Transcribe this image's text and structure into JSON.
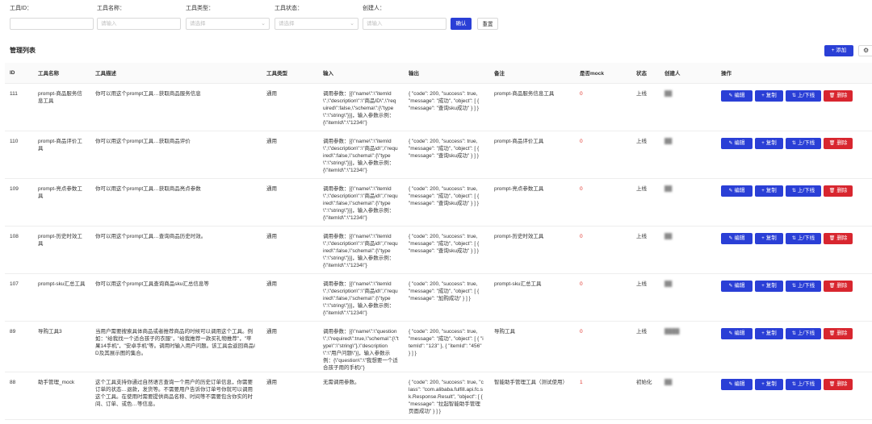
{
  "filters": {
    "tool_id": {
      "label": "工具ID：",
      "placeholder": ""
    },
    "tool_name": {
      "label": "工具名称：",
      "placeholder": "请输入"
    },
    "tool_type": {
      "label": "工具类型：",
      "placeholder": "请选择"
    },
    "tool_status": {
      "label": "工具状态：",
      "placeholder": "请选择"
    },
    "creator": {
      "label": "创建人：",
      "placeholder": "请输入"
    },
    "confirm_label": "确认",
    "reset_label": "重置"
  },
  "list": {
    "title": "管理列表",
    "add_label": "+ 添加",
    "settings_icon": "gear-icon"
  },
  "table": {
    "columns": [
      "ID",
      "工具名称",
      "工具描述",
      "工具类型",
      "输入",
      "输出",
      "备注",
      "是否mock",
      "状态",
      "创建人",
      "操作"
    ],
    "actions": {
      "edit": "编辑",
      "copy": "复制",
      "shelf": "上/下线",
      "delete": "删除"
    },
    "rows": [
      {
        "id": "111",
        "name": "prompt-商品服务信息工具",
        "desc": "你可以用这个prompt工具…获取商品服务信息",
        "type": "通用",
        "input": "调用参数：[{\\\"name\\\":\\\"itemId\\\",\\\"description\\\":\\\"商品ID\\\",\\\"required\\\":false,\\\"schema\\\":{\\\"type\\\":\\\"string\\\"}}]，输入参数示例：{\\\"itemId\\\":\\\"1234\\\"}",
        "output": "{ \"code\": 200, \"success\": true, \"message\": \"成功\", \"object\": [ { \"message\": \"查询sku成功\" } ] }",
        "note": "prompt-商品服务信息工具",
        "mock": "0",
        "status": "上线",
        "creator": "██"
      },
      {
        "id": "110",
        "name": "prompt-商品评价工具",
        "desc": "你可以用这个prompt工具…获取商品评价",
        "type": "通用",
        "input": "调用参数：[{\\\"name\\\":\\\"itemId\\\",\\\"description\\\":\\\"商品id\\\",\\\"required\\\":false,\\\"schema\\\":{\\\"type\\\":\\\"string\\\"}}]，输入参数示例：{\\\"itemId\\\":\\\"1234\\\"}",
        "output": "{ \"code\": 200, \"success\": true, \"message\": \"成功\", \"object\": [ { \"message\": \"查询sku成功\" } ] }",
        "note": "prompt-商品评价工具",
        "mock": "0",
        "status": "上线",
        "creator": "██"
      },
      {
        "id": "109",
        "name": "prompt-亮点参数工具",
        "desc": "你可以用这个prompt工具…获取商品亮点参数",
        "type": "通用",
        "input": "调用参数：[{\\\"name\\\":\\\"itemId\\\",\\\"description\\\":\\\"商品id\\\",\\\"required\\\":false,\\\"schema\\\":{\\\"type\\\":\\\"string\\\"}}]，输入参数示例：{\\\"itemId\\\":\\\"1234\\\"}",
        "output": "{ \"code\": 200, \"success\": true, \"message\": \"成功\", \"object\": [ { \"message\": \"查询sku成功\" } ] }",
        "note": "prompt-亮点参数工具",
        "mock": "0",
        "status": "上线",
        "creator": "██"
      },
      {
        "id": "108",
        "name": "prompt-历史时效工具",
        "desc": "你可以用这个prompt工具…查询商品历史时效。",
        "type": "通用",
        "input": "调用参数：[{\\\"name\\\":\\\"itemId\\\",\\\"description\\\":\\\"商品id\\\",\\\"required\\\":false,\\\"schema\\\":{\\\"type\\\":\\\"string\\\"}}]，输入参数示例：{\\\"itemId\\\":\\\"1234\\\"}",
        "output": "{ \"code\": 200, \"success\": true, \"message\": \"成功\", \"object\": [ { \"message\": \"查询sku成功\" } ] }",
        "note": "prompt-历史时效工具",
        "mock": "0",
        "status": "上线",
        "creator": "██"
      },
      {
        "id": "107",
        "name": "prompt-sku汇总工具",
        "desc": "你可以用这个prompt工具查询商品sku汇总信息等",
        "type": "通用",
        "input": "调用参数：[{\\\"name\\\":\\\"itemId\\\",\\\"description\\\":\\\"商品id\\\",\\\"required\\\":false,\\\"schema\\\":{\\\"type\\\":\\\"string\\\"}}]，输入参数示例：{\\\"itemId\\\":\\\"1234\\\"}",
        "output": "{ \"code\": 200, \"success\": true, \"message\": \"成功\", \"object\": [ { \"message\": \"加购成功\" } ] }",
        "note": "prompt-sku汇总工具",
        "mock": "0",
        "status": "上线",
        "creator": "██"
      },
      {
        "id": "89",
        "name": "导购工具3",
        "desc": "当用户需要搜索具体商品或者推荐商品的时候可以调用这个工具。例如：\"给我找一个适合孩子的衣服\"，\"给我推荐一款买礼物推荐\"，\"苹果14手机\"，\"安卓手机\"等。调用时输入用户问题。该工具会返回商品ID及其展示图的集合。",
        "type": "通用",
        "input": "调用参数：[{\\\"name\\\":\\\"question\\\",\\\"required\\\":true,\\\"schema\\\":{\\\"type\\\":\\\"string\\\"},\\\"description\\\":\\\"用户问题\\\"}]，输入参数示例：{\\\"question\\\":\\\"我想要一个适合孩子用的手机\\\"}",
        "output": "{ \"code\": 200, \"success\": true, \"message\": \"成功\", \"object\": [ { \"itemId\": \"123\" }, { \"itemId\": \"456\" } ] }",
        "note": "导购工具",
        "mock": "0",
        "status": "上线",
        "creator": "████"
      },
      {
        "id": "88",
        "name": "助手管理_mock",
        "desc": "这个工具支持你通过自然语言查询一个用户的历史订单信息，你需要订单的状态…退款，发货等。不需要用户告诉你订单号你就可以调用这个工具。在使用时需要提供商品名称、时间等不需要包含你实的时间、订单、或色…等信息。",
        "type": "通用",
        "input": "无需调用参数。",
        "output": "{ \"code\": 200, \"success\": true, \"class\": \"com.alibaba.fulfill.api.fc.sk.Response.Result\", \"object\": [ { \"message\": \"拉起智能助手管理页面成功\" } ] }",
        "note": "智能助手管理工具（测试使用）",
        "mock": "1",
        "status": "初始化",
        "creator": "██"
      }
    ]
  }
}
